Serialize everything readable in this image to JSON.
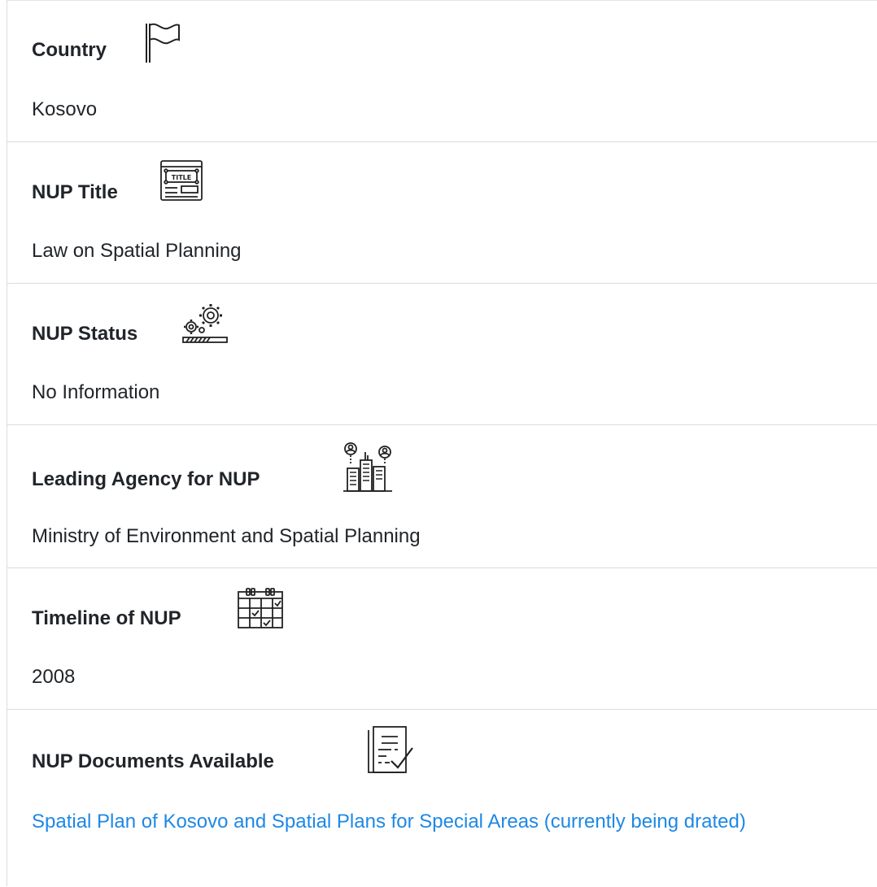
{
  "fields": [
    {
      "label": "Country",
      "icon": "flag-icon",
      "value": "Kosovo"
    },
    {
      "label": "NUP Title",
      "icon": "title-icon",
      "icon_text": "TITLE",
      "value": "Law on Spatial Planning"
    },
    {
      "label": "NUP Status",
      "icon": "gears-progress-icon",
      "value": "No Information"
    },
    {
      "label": "Leading Agency for NUP",
      "icon": "agency-building-icon",
      "value": "Ministry of Environment and Spatial Planning"
    },
    {
      "label": "Timeline of NUP",
      "icon": "calendar-icon",
      "value": "2008"
    },
    {
      "label": "NUP Documents Available",
      "icon": "document-check-icon",
      "value": "Spatial Plan of Kosovo and Spatial Plans for Special Areas (currently being drated)"
    }
  ],
  "colors": {
    "text": "#212529",
    "link": "#1e88e5",
    "divider": "#dcdcdc"
  }
}
